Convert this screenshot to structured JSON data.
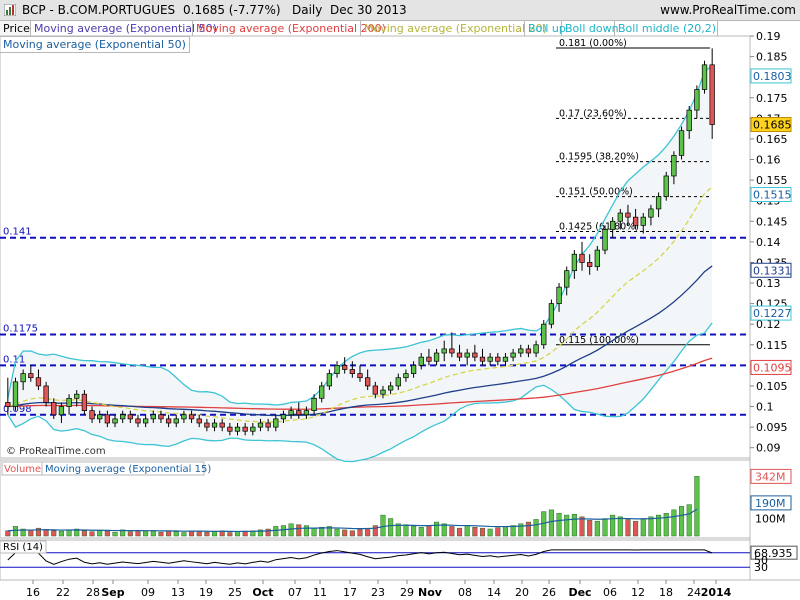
{
  "header": {
    "symbol": "BCP - B.COM.PORTUGUES",
    "quote": "0.1685 (-7.77%)",
    "period": "Daily",
    "date": "Dec 30 2013",
    "website": "www.ProRealTime.com",
    "icon": "chart-app-icon"
  },
  "legend": {
    "price": "Price",
    "ema50": "Moving average (Exponential 50)",
    "ema200": "Moving average (Exponential 200)",
    "ema20": "Moving average (Exponential 20)",
    "boll_up": "Boll up",
    "boll_down": "Boll down",
    "boll_middle": "Boll middle (20,2)",
    "ema50_row2": "Moving average (Exponential 50)"
  },
  "watermark": "© ProRealTime.com",
  "volume_legend": {
    "volume": "Volume",
    "ema": "Moving average (Exponential 15)"
  },
  "rsi_legend": "RSI (14)",
  "colors": {
    "up_candle": "#5cc24a",
    "down_candle": "#e05555",
    "ema20": "#d7d44c",
    "ema50": "#1f3f8a",
    "ema200": "#e04040",
    "bollinger": "#3cc4d6",
    "hline": "#1010c0",
    "price_tag": "#ffd21c",
    "accent_text": "#1a5fa0"
  },
  "chart_data": [
    {
      "type": "candlestick",
      "title": "BCP - B.COM.PORTUGUES",
      "ylim": [
        0.0875,
        0.19
      ],
      "yticks": [
        "0.19",
        "0.185",
        "0.18",
        "0.175",
        "0.17",
        "0.165",
        "0.16",
        "0.155",
        "0.15",
        "0.145",
        "0.14",
        "0.135",
        "0.13",
        "0.125",
        "0.12",
        "0.115",
        "0.11",
        "0.105",
        "0.1",
        "0.095",
        "0.09"
      ],
      "x_labels": [
        "16",
        "22",
        "28",
        "Sep",
        "09",
        "13",
        "19",
        "25",
        "Oct",
        "07",
        "11",
        "17",
        "23",
        "29",
        "Nov",
        "08",
        "14",
        "20",
        "26",
        "Dec",
        "06",
        "12",
        "18",
        "24",
        "2014"
      ],
      "right_tags": [
        {
          "label": "0.1803",
          "value": 0.1803,
          "style": "bollinger"
        },
        {
          "label": "0.1685",
          "value": 0.1685,
          "style": "price"
        },
        {
          "label": "0.1515",
          "value": 0.1515,
          "style": "bollinger"
        },
        {
          "label": "0.1331",
          "value": 0.1331,
          "style": "ema50"
        },
        {
          "label": "0.1227",
          "value": 0.1227,
          "style": "bollinger"
        },
        {
          "label": "0.1095",
          "value": 0.1095,
          "style": "ema200"
        }
      ],
      "horizontal_levels": [
        {
          "label": "0.141",
          "value": 0.141
        },
        {
          "label": "0.1175",
          "value": 0.1175
        },
        {
          "label": "0.11",
          "value": 0.11
        },
        {
          "label": "0.098",
          "value": 0.098
        }
      ],
      "fibonacci": [
        {
          "label": "0.181 (0.00%)",
          "value": 0.1871
        },
        {
          "label": "0.17 (23.60%)",
          "value": 0.17
        },
        {
          "label": "0.1595 (38.20%)",
          "value": 0.1595
        },
        {
          "label": "0.151 (50.00%)",
          "value": 0.151
        },
        {
          "label": "0.1425 (61.80%)",
          "value": 0.1425
        },
        {
          "label": "0.115 (100.00%)",
          "value": 0.115
        }
      ],
      "candles": [
        [
          0.101,
          0.107,
          0.098,
          0.1
        ],
        [
          0.1,
          0.107,
          0.099,
          0.106
        ],
        [
          0.106,
          0.109,
          0.104,
          0.108
        ],
        [
          0.108,
          0.11,
          0.106,
          0.107
        ],
        [
          0.107,
          0.109,
          0.104,
          0.105
        ],
        [
          0.105,
          0.106,
          0.1,
          0.101
        ],
        [
          0.101,
          0.102,
          0.097,
          0.098
        ],
        [
          0.098,
          0.101,
          0.096,
          0.1
        ],
        [
          0.1,
          0.103,
          0.098,
          0.102
        ],
        [
          0.102,
          0.104,
          0.1,
          0.103
        ],
        [
          0.103,
          0.104,
          0.098,
          0.099
        ],
        [
          0.099,
          0.1,
          0.096,
          0.097
        ],
        [
          0.097,
          0.099,
          0.096,
          0.098
        ],
        [
          0.098,
          0.099,
          0.095,
          0.096
        ],
        [
          0.096,
          0.098,
          0.095,
          0.097
        ],
        [
          0.097,
          0.099,
          0.096,
          0.098
        ],
        [
          0.098,
          0.099,
          0.096,
          0.097
        ],
        [
          0.097,
          0.098,
          0.095,
          0.096
        ],
        [
          0.096,
          0.098,
          0.095,
          0.097
        ],
        [
          0.097,
          0.099,
          0.096,
          0.098
        ],
        [
          0.098,
          0.099,
          0.096,
          0.097
        ],
        [
          0.097,
          0.098,
          0.095,
          0.096
        ],
        [
          0.096,
          0.098,
          0.095,
          0.097
        ],
        [
          0.097,
          0.099,
          0.096,
          0.098
        ],
        [
          0.098,
          0.099,
          0.096,
          0.097
        ],
        [
          0.097,
          0.098,
          0.095,
          0.096
        ],
        [
          0.096,
          0.097,
          0.094,
          0.095
        ],
        [
          0.095,
          0.097,
          0.094,
          0.096
        ],
        [
          0.096,
          0.097,
          0.094,
          0.095
        ],
        [
          0.095,
          0.096,
          0.093,
          0.094
        ],
        [
          0.094,
          0.096,
          0.093,
          0.095
        ],
        [
          0.095,
          0.096,
          0.093,
          0.094
        ],
        [
          0.094,
          0.096,
          0.093,
          0.095
        ],
        [
          0.095,
          0.097,
          0.094,
          0.096
        ],
        [
          0.096,
          0.097,
          0.094,
          0.095
        ],
        [
          0.095,
          0.098,
          0.094,
          0.097
        ],
        [
          0.097,
          0.099,
          0.096,
          0.098
        ],
        [
          0.098,
          0.1,
          0.097,
          0.099
        ],
        [
          0.099,
          0.101,
          0.097,
          0.098
        ],
        [
          0.098,
          0.1,
          0.097,
          0.099
        ],
        [
          0.099,
          0.103,
          0.098,
          0.102
        ],
        [
          0.102,
          0.106,
          0.101,
          0.105
        ],
        [
          0.105,
          0.109,
          0.104,
          0.108
        ],
        [
          0.108,
          0.111,
          0.107,
          0.11
        ],
        [
          0.11,
          0.112,
          0.108,
          0.109
        ],
        [
          0.109,
          0.111,
          0.107,
          0.108
        ],
        [
          0.108,
          0.11,
          0.106,
          0.107
        ],
        [
          0.107,
          0.109,
          0.104,
          0.105
        ],
        [
          0.105,
          0.106,
          0.102,
          0.103
        ],
        [
          0.103,
          0.105,
          0.102,
          0.104
        ],
        [
          0.104,
          0.106,
          0.103,
          0.105
        ],
        [
          0.105,
          0.108,
          0.104,
          0.107
        ],
        [
          0.107,
          0.109,
          0.106,
          0.108
        ],
        [
          0.108,
          0.111,
          0.107,
          0.11
        ],
        [
          0.11,
          0.113,
          0.109,
          0.112
        ],
        [
          0.112,
          0.114,
          0.11,
          0.111
        ],
        [
          0.111,
          0.114,
          0.11,
          0.113
        ],
        [
          0.113,
          0.116,
          0.111,
          0.114
        ],
        [
          0.114,
          0.118,
          0.112,
          0.113
        ],
        [
          0.113,
          0.115,
          0.111,
          0.112
        ],
        [
          0.112,
          0.114,
          0.11,
          0.113
        ],
        [
          0.113,
          0.115,
          0.111,
          0.112
        ],
        [
          0.112,
          0.114,
          0.11,
          0.111
        ],
        [
          0.111,
          0.113,
          0.11,
          0.112
        ],
        [
          0.112,
          0.113,
          0.11,
          0.111
        ],
        [
          0.111,
          0.113,
          0.11,
          0.112
        ],
        [
          0.112,
          0.114,
          0.111,
          0.113
        ],
        [
          0.113,
          0.115,
          0.112,
          0.114
        ],
        [
          0.114,
          0.115,
          0.112,
          0.113
        ],
        [
          0.113,
          0.116,
          0.112,
          0.115
        ],
        [
          0.115,
          0.121,
          0.114,
          0.12
        ],
        [
          0.12,
          0.126,
          0.119,
          0.125
        ],
        [
          0.125,
          0.13,
          0.123,
          0.129
        ],
        [
          0.129,
          0.134,
          0.127,
          0.133
        ],
        [
          0.133,
          0.138,
          0.131,
          0.137
        ],
        [
          0.137,
          0.14,
          0.133,
          0.135
        ],
        [
          0.135,
          0.137,
          0.132,
          0.134
        ],
        [
          0.134,
          0.139,
          0.133,
          0.138
        ],
        [
          0.138,
          0.144,
          0.137,
          0.143
        ],
        [
          0.143,
          0.146,
          0.141,
          0.145
        ],
        [
          0.145,
          0.148,
          0.143,
          0.147
        ],
        [
          0.147,
          0.149,
          0.144,
          0.146
        ],
        [
          0.146,
          0.148,
          0.143,
          0.144
        ],
        [
          0.144,
          0.147,
          0.142,
          0.146
        ],
        [
          0.146,
          0.149,
          0.144,
          0.148
        ],
        [
          0.148,
          0.152,
          0.146,
          0.151
        ],
        [
          0.151,
          0.157,
          0.15,
          0.156
        ],
        [
          0.156,
          0.162,
          0.154,
          0.161
        ],
        [
          0.161,
          0.168,
          0.16,
          0.167
        ],
        [
          0.167,
          0.173,
          0.165,
          0.172
        ],
        [
          0.172,
          0.178,
          0.17,
          0.177
        ],
        [
          0.177,
          0.184,
          0.176,
          0.183
        ],
        [
          0.183,
          0.187,
          0.165,
          0.1685
        ]
      ]
    },
    {
      "type": "bar",
      "title": "Volume",
      "ylim": [
        0,
        350
      ],
      "yticks": [
        "342M",
        "190M",
        "100M"
      ],
      "values": [
        30,
        55,
        40,
        35,
        45,
        38,
        30,
        28,
        35,
        40,
        30,
        25,
        32,
        28,
        22,
        35,
        25,
        30,
        28,
        32,
        22,
        28,
        25,
        20,
        30,
        28,
        22,
        25,
        30,
        20,
        25,
        28,
        30,
        35,
        40,
        55,
        60,
        70,
        65,
        60,
        45,
        50,
        55,
        40,
        35,
        30,
        38,
        45,
        60,
        120,
        100,
        70,
        65,
        55,
        50,
        60,
        80,
        70,
        55,
        45,
        60,
        50,
        45,
        40,
        48,
        55,
        60,
        70,
        80,
        95,
        140,
        150,
        130,
        120,
        125,
        110,
        90,
        85,
        100,
        120,
        110,
        95,
        85,
        100,
        110,
        120,
        130,
        150,
        170,
        180,
        342
      ],
      "ema15_label": "190M"
    },
    {
      "type": "line",
      "title": "RSI (14)",
      "ylim": [
        0,
        100
      ],
      "yticks": [
        "68.935",
        "50",
        "30"
      ],
      "last_value": 68.935
    }
  ]
}
